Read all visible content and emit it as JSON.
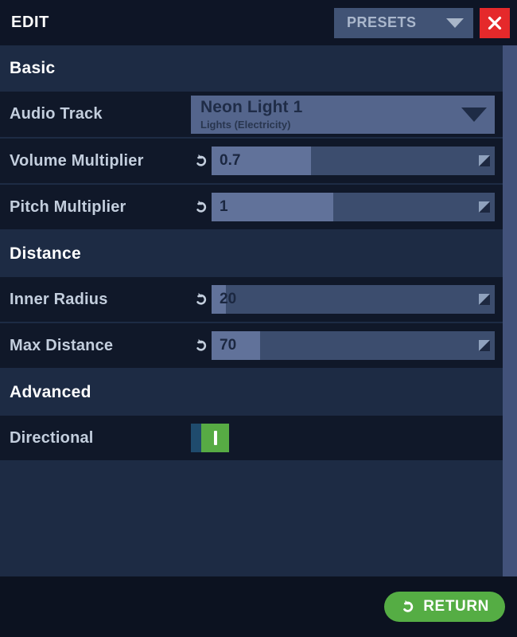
{
  "header": {
    "title": "EDIT",
    "presets_label": "PRESETS",
    "presets_icon": "chevron-down-icon",
    "close_icon": "close-icon"
  },
  "sections": [
    {
      "title": "Basic",
      "rows": [
        {
          "label": "Audio Track",
          "type": "dropdown",
          "value": "Neon Light 1",
          "subtitle": "Lights (Electricity)",
          "icon": "chevron-down-icon"
        },
        {
          "label": "Volume Multiplier",
          "type": "slider",
          "value": "0.7",
          "fill_percent": 35,
          "reset_icon": "undo-arrow-icon",
          "grip_icon": "resize-grip-icon"
        },
        {
          "label": "Pitch Multiplier",
          "type": "slider",
          "value": "1",
          "fill_percent": 43,
          "reset_icon": "undo-arrow-icon",
          "grip_icon": "resize-grip-icon"
        }
      ]
    },
    {
      "title": "Distance",
      "rows": [
        {
          "label": "Inner Radius",
          "type": "slider",
          "value": "20",
          "fill_percent": 5,
          "reset_icon": "undo-arrow-icon",
          "grip_icon": "resize-grip-icon"
        },
        {
          "label": "Max Distance",
          "type": "slider",
          "value": "70",
          "fill_percent": 17,
          "reset_icon": "undo-arrow-icon",
          "grip_icon": "resize-grip-icon"
        }
      ]
    },
    {
      "title": "Advanced",
      "rows": [
        {
          "label": "Directional",
          "type": "toggle",
          "state": "on"
        }
      ]
    }
  ],
  "footer": {
    "return_label": "RETURN",
    "return_icon": "undo-arrow-icon"
  },
  "colors": {
    "accent_green": "#55ad44",
    "danger_red": "#e5292b",
    "panel_dark": "#101829",
    "panel_navy": "#1d2b44",
    "slider_track": "#3c4d6e",
    "slider_fill": "#61729a"
  }
}
